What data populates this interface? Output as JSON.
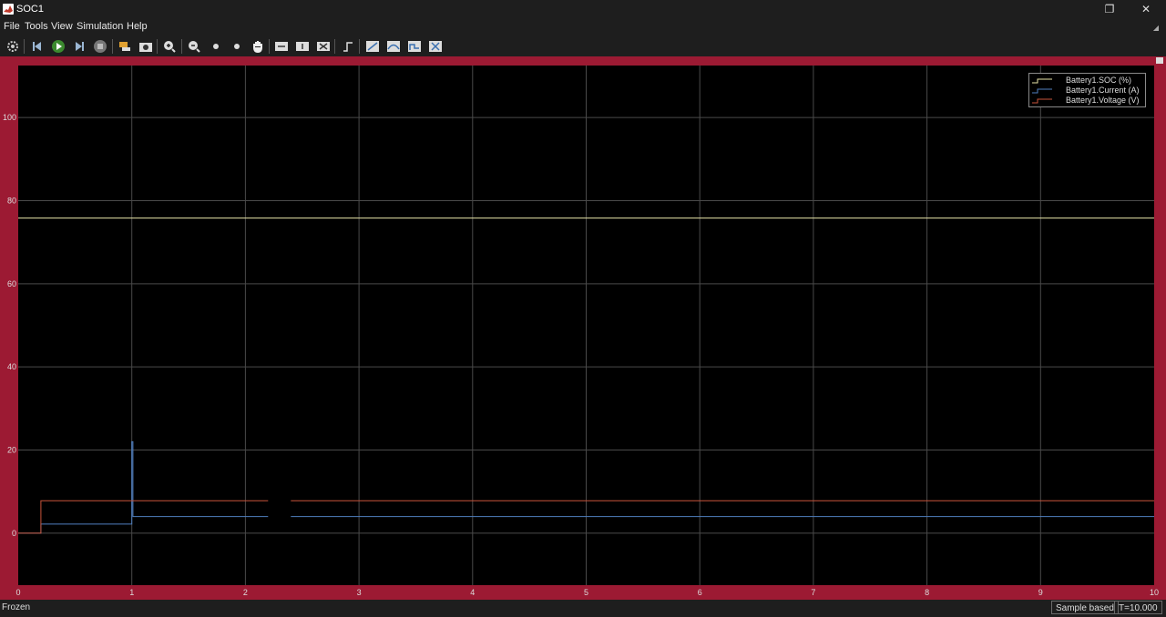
{
  "window": {
    "title": "SOC1"
  },
  "menu": {
    "items": [
      "File",
      "Tools",
      "View",
      "Simulation",
      "Help"
    ]
  },
  "toolbar": {
    "icons": [
      "settings-icon",
      "step-back-icon",
      "run-icon",
      "step-forward-icon",
      "stop-icon",
      "highlight-block-icon",
      "snapshot-icon",
      "zoom-in-icon",
      "zoom-out-icon",
      "zoom-x-icon",
      "zoom-y-icon",
      "pan-icon",
      "fit-to-view-icon",
      "scale-x-icon",
      "scale-y-icon",
      "triggers-icon",
      "cursor-measurements-icon",
      "signal-statistics-icon",
      "peak-finder-icon",
      "bilevel-measurements-icon"
    ]
  },
  "colors": {
    "frame": "#9c1a33",
    "axes_bg": "#000000",
    "grid": "#4a4a4a",
    "soc": "#e8e4a8",
    "current": "#4f7fbf",
    "voltage": "#c8543a"
  },
  "chart_data": {
    "type": "line",
    "title": "",
    "xlabel": "",
    "ylabel": "",
    "xlim": [
      0,
      10
    ],
    "ylim": [
      -12.5,
      112.5
    ],
    "xticks": [
      0,
      1,
      2,
      3,
      4,
      5,
      6,
      7,
      8,
      9,
      10
    ],
    "yticks": [
      0,
      20,
      40,
      60,
      80,
      100
    ],
    "grid": true,
    "legend_position": "top-right",
    "series": [
      {
        "name": "Battery1.SOC (%)",
        "color": "#e8e4a8",
        "x": [
          0,
          10
        ],
        "y": [
          75.8,
          75.8
        ]
      },
      {
        "name": "Battery1.Current (A)",
        "color": "#4f7fbf",
        "x": [
          0,
          0.2,
          0.2,
          1.0,
          1.0,
          1.01,
          1.01,
          2.2
        ],
        "y": [
          0,
          0,
          2.2,
          2.2,
          22.0,
          22.0,
          4.0,
          4.0
        ],
        "x2": [
          2.4,
          10
        ],
        "y2": [
          4.0,
          4.0
        ]
      },
      {
        "name": "Battery1.Voltage (V)",
        "color": "#c8543a",
        "x": [
          0,
          0.2,
          0.2,
          2.2
        ],
        "y": [
          0,
          0,
          7.8,
          7.8
        ],
        "x2": [
          2.4,
          10
        ],
        "y2": [
          7.8,
          7.8
        ]
      }
    ]
  },
  "status": {
    "state": "Frozen",
    "mode": "Sample based",
    "time": "T=10.000"
  }
}
